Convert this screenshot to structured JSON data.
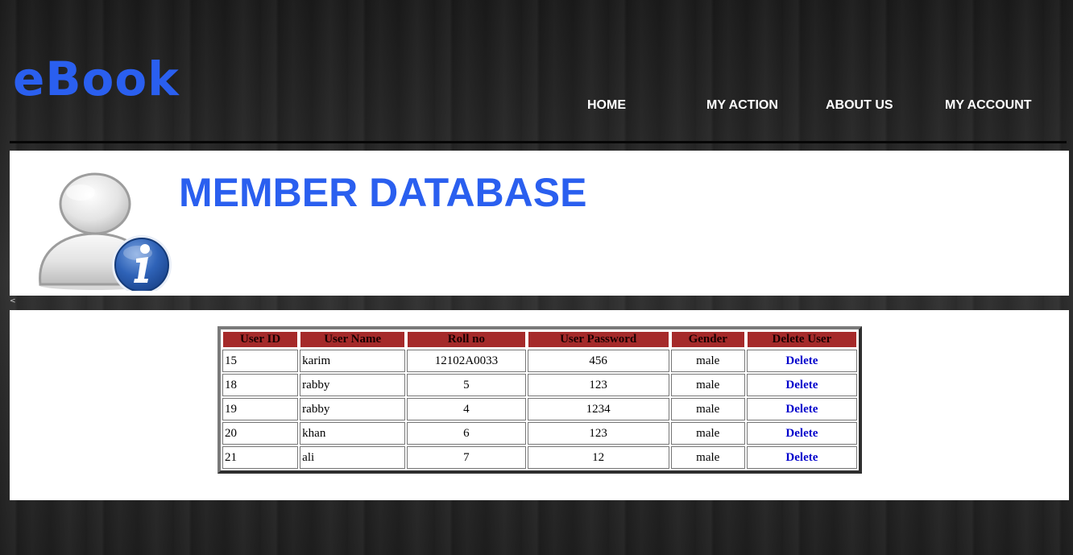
{
  "header": {
    "logo": "eBook",
    "nav": [
      {
        "label": "HOME"
      },
      {
        "label": "MY ACTION"
      },
      {
        "label": "ABOUT US"
      },
      {
        "label": "MY ACCOUNT"
      }
    ]
  },
  "banner": {
    "title": "MEMBER DATABASE",
    "icon": "user-info-icon"
  },
  "gap_glyph": "<",
  "table": {
    "headers": [
      "User ID",
      "User Name",
      "Roll no",
      "User Password",
      "Gender",
      "Delete User"
    ],
    "rows": [
      {
        "id": "15",
        "name": "karim",
        "roll": "12102A0033",
        "password": "456",
        "gender": "male",
        "action": "Delete"
      },
      {
        "id": "18",
        "name": "rabby",
        "roll": "5",
        "password": "123",
        "gender": "male",
        "action": "Delete"
      },
      {
        "id": "19",
        "name": "rabby",
        "roll": "4",
        "password": "1234",
        "gender": "male",
        "action": "Delete"
      },
      {
        "id": "20",
        "name": "khan",
        "roll": "6",
        "password": "123",
        "gender": "male",
        "action": "Delete"
      },
      {
        "id": "21",
        "name": "ali",
        "roll": "7",
        "password": "12",
        "gender": "male",
        "action": "Delete"
      }
    ]
  },
  "colors": {
    "accent": "#2a5fef",
    "header_cell": "#a52a2a",
    "link": "#0000cc"
  }
}
